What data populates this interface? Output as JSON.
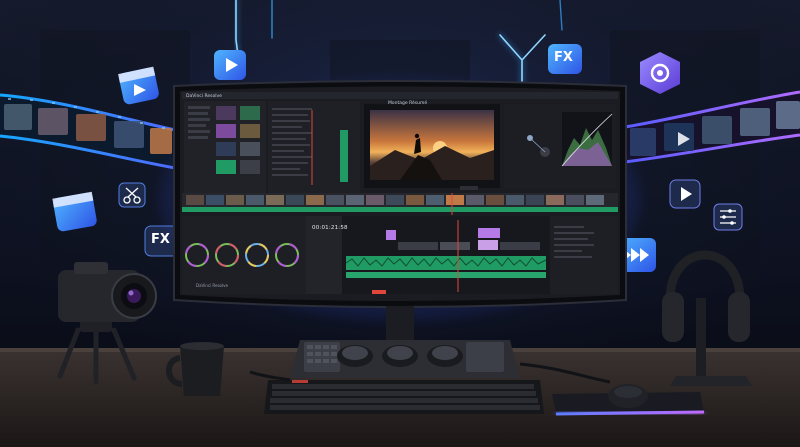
{
  "screen": {
    "app_title": "DaVinci Resolve",
    "viewer_title": "Montage Résumé",
    "timecode": "00:01:21:58",
    "logo_text": "DaVinci Resolve"
  },
  "floating_badges": {
    "fx_top": "FX",
    "fx_left": "FX"
  },
  "colors": {
    "accent_blue": "#39a8ff",
    "accent_purple": "#a56bff",
    "timeline_green": "#1f9b63",
    "clip_purple": "#b47be8",
    "playhead_red": "#e0463b"
  },
  "icons": [
    "clapper-icon",
    "play-icon",
    "fx-badge",
    "scissors-icon",
    "fast-forward-icon",
    "sliders-icon",
    "logo-badge-icon"
  ]
}
